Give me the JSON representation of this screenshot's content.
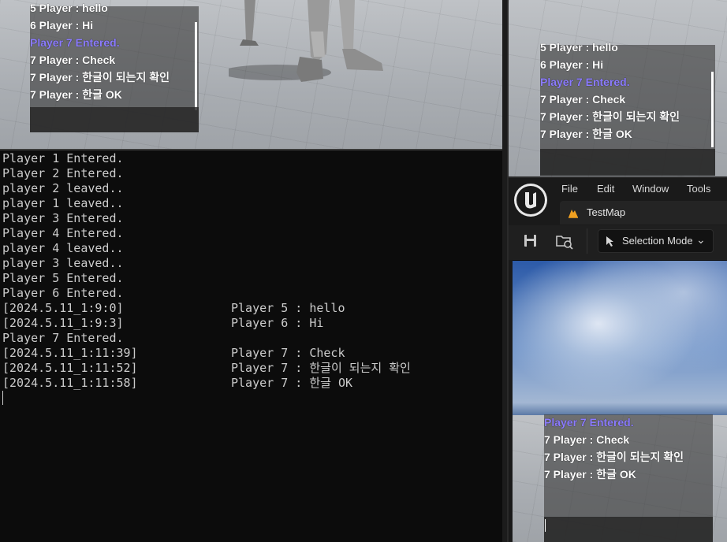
{
  "top_left_chat": {
    "lines": [
      {
        "name": "5 Player",
        "sep": " : ",
        "text": "hello",
        "system": false
      },
      {
        "name": "6 Player",
        "sep": " : ",
        "text": "Hi",
        "system": false
      },
      {
        "name": "",
        "sep": "",
        "text": "Player 7 Entered.",
        "system": true
      },
      {
        "name": "7 Player",
        "sep": " : ",
        "text": "Check",
        "system": false
      },
      {
        "name": "7 Player",
        "sep": " : ",
        "text": "한글이 되는지 확인",
        "system": false
      },
      {
        "name": "7 Player",
        "sep": " : ",
        "text": "한글 OK",
        "system": false
      }
    ]
  },
  "console": {
    "lines": [
      {
        "left": "Player 1 Entered.",
        "msg": ""
      },
      {
        "left": "Player 2 Entered.",
        "msg": ""
      },
      {
        "left": "player 2 leaved..",
        "msg": ""
      },
      {
        "left": "player 1 leaved..",
        "msg": ""
      },
      {
        "left": "Player 3 Entered.",
        "msg": ""
      },
      {
        "left": "Player 4 Entered.",
        "msg": ""
      },
      {
        "left": "player 4 leaved..",
        "msg": ""
      },
      {
        "left": "player 3 leaved..",
        "msg": ""
      },
      {
        "left": "Player 5 Entered.",
        "msg": ""
      },
      {
        "left": "Player 6 Entered.",
        "msg": ""
      },
      {
        "left": "[2024.5.11_1:9:0]",
        "msg": "Player 5 : hello"
      },
      {
        "left": "[2024.5.11_1:9:3]",
        "msg": "Player 6 : Hi"
      },
      {
        "left": "Player 7 Entered.",
        "msg": ""
      },
      {
        "left": "[2024.5.11_1:11:39]",
        "msg": "Player 7 : Check"
      },
      {
        "left": "[2024.5.11_1:11:52]",
        "msg": "Player 7 : 한글이 되는지 확인"
      },
      {
        "left": "[2024.5.11_1:11:58]",
        "msg": "Player 7 : 한글 OK"
      }
    ]
  },
  "top_right_chat": {
    "lines": [
      {
        "name": "5 Player",
        "sep": " : ",
        "text": "hello",
        "system": false
      },
      {
        "name": "6 Player",
        "sep": " : ",
        "text": "Hi",
        "system": false
      },
      {
        "name": "",
        "sep": "",
        "text": "Player 7 Entered.",
        "system": true
      },
      {
        "name": "7 Player",
        "sep": " : ",
        "text": "Check",
        "system": false
      },
      {
        "name": "7 Player",
        "sep": " : ",
        "text": "한글이 되는지 확인",
        "system": false
      },
      {
        "name": "7 Player",
        "sep": " : ",
        "text": "한글 OK",
        "system": false
      }
    ]
  },
  "editor": {
    "menu": [
      "File",
      "Edit",
      "Window",
      "Tools"
    ],
    "map_tab": "TestMap",
    "selection_mode": "Selection Mode",
    "accent": "#f0a020"
  },
  "bottom_right_chat": {
    "lines": [
      {
        "name": "",
        "sep": "",
        "text": "Player 7 Entered.",
        "system": true
      },
      {
        "name": "7 Player",
        "sep": " : ",
        "text": "Check",
        "system": false
      },
      {
        "name": "7 Player",
        "sep": " : ",
        "text": "한글이 되는지 확인",
        "system": false
      },
      {
        "name": "7 Player",
        "sep": " : ",
        "text": "한글 OK",
        "system": false
      }
    ]
  }
}
